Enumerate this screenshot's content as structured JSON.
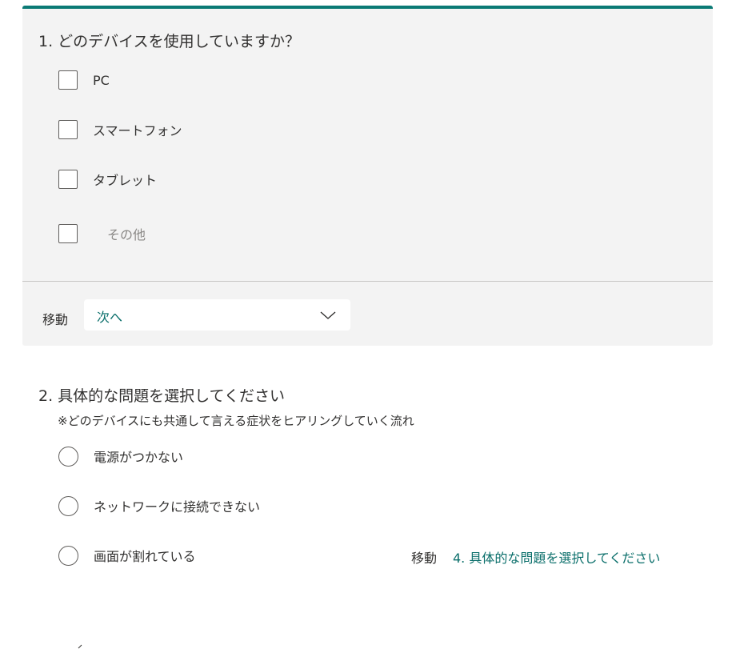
{
  "colors": {
    "accent": "#0b7a75",
    "link": "#0b6f6b",
    "card_bg": "#f3f3f3"
  },
  "question1": {
    "title": "1. どのデバイスを使用していますか？",
    "options": [
      {
        "label": "PC",
        "checked": false
      },
      {
        "label": "スマートフォン",
        "checked": false
      },
      {
        "label": "タブレット",
        "checked": false
      }
    ],
    "other_placeholder": "その他",
    "branch": {
      "label": "移動",
      "value": "次へ",
      "icon": "chevron-down-icon"
    }
  },
  "question2": {
    "title": "2. 具体的な問題を選択してください",
    "subtitle": "※どのデバイスにも共通して言える症状をヒアリングしていく流れ",
    "options": [
      {
        "label": "電源がつかない",
        "selected": false
      },
      {
        "label": "ネットワークに接続できない",
        "selected": false
      },
      {
        "label": "画面が割れている",
        "selected": false
      }
    ],
    "branch": {
      "label": "移動",
      "target": "4. 具体的な問題を選択してください"
    }
  }
}
